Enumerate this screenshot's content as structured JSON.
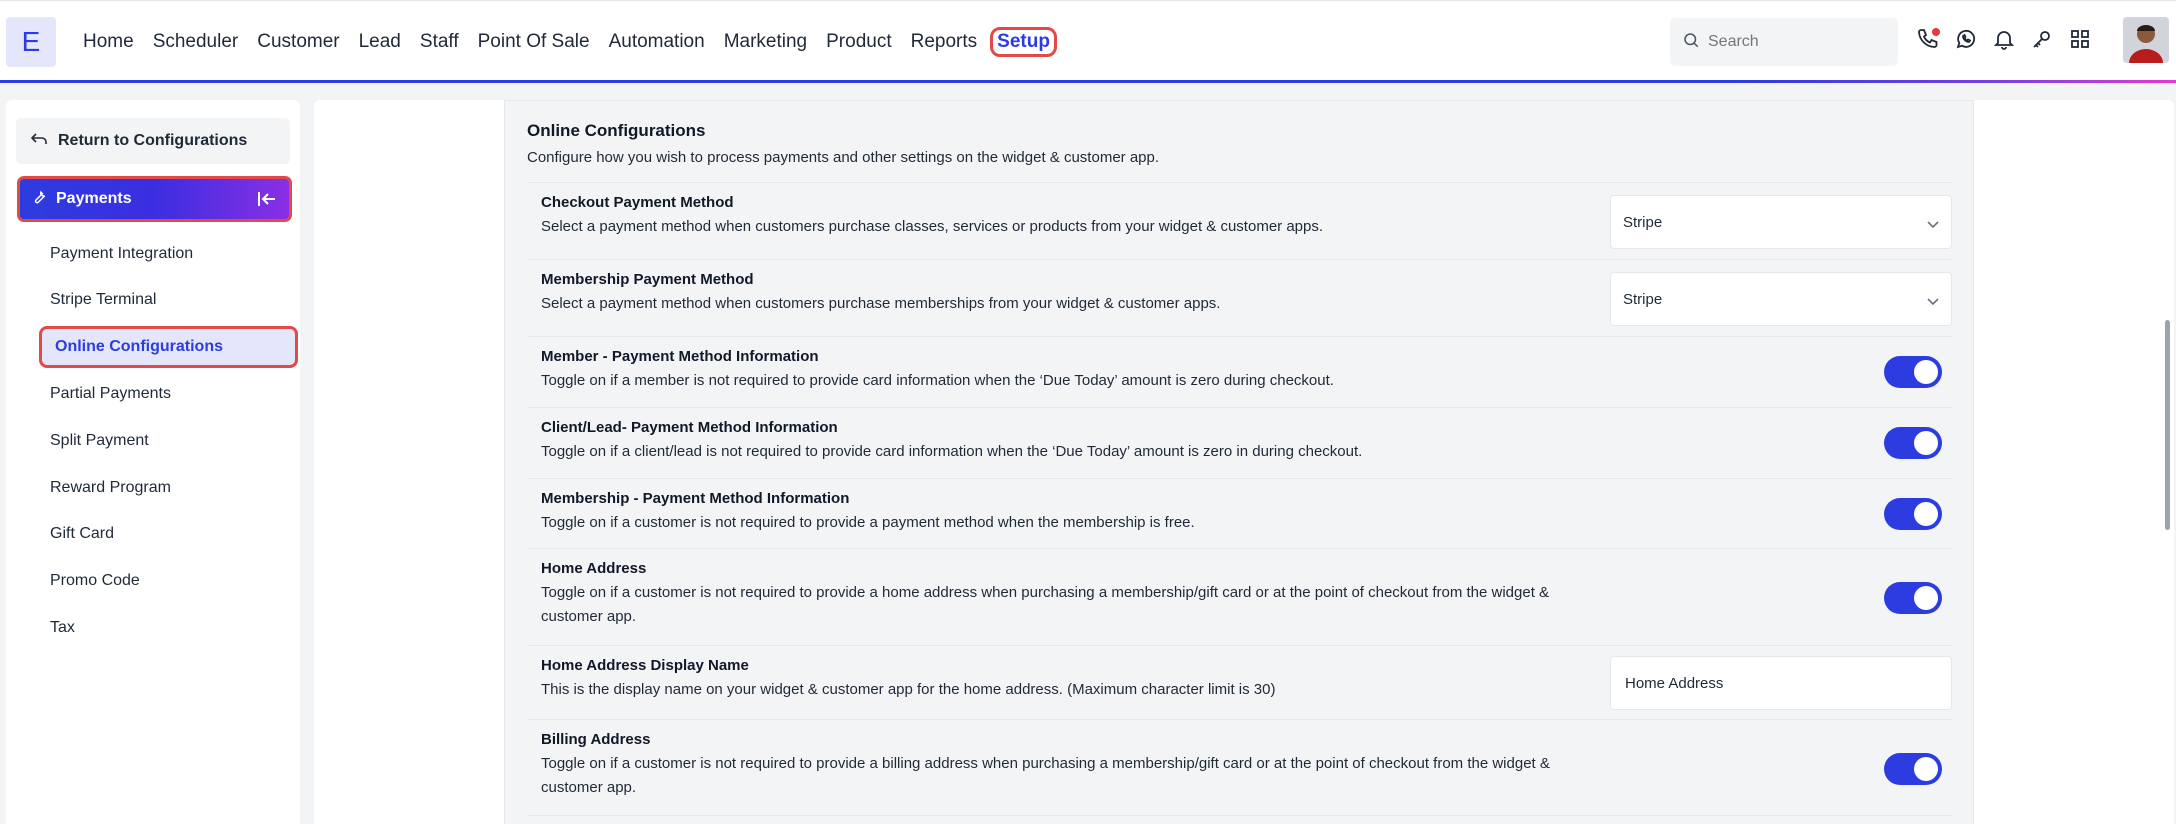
{
  "logo": {
    "letter": "E"
  },
  "nav": {
    "items": [
      "Home",
      "Scheduler",
      "Customer",
      "Lead",
      "Staff",
      "Point Of Sale",
      "Automation",
      "Marketing",
      "Product",
      "Reports"
    ],
    "active": "Setup"
  },
  "search": {
    "placeholder": "Search"
  },
  "sidebar": {
    "return_label": "Return to Configurations",
    "section_label": "Payments",
    "items": [
      "Payment Integration",
      "Stripe Terminal",
      "Online Configurations",
      "Partial Payments",
      "Split Payment",
      "Reward Program",
      "Gift Card",
      "Promo Code",
      "Tax"
    ],
    "active_index": 2
  },
  "panel": {
    "title": "Online Configurations",
    "description": "Configure how you wish to process payments and other settings on the widget & customer app.",
    "rows": [
      {
        "title": "Checkout Payment Method",
        "desc": "Select a payment method when customers purchase classes, services or products from your widget & customer apps.",
        "control": "select",
        "value": "Stripe"
      },
      {
        "title": "Membership Payment Method",
        "desc": "Select a payment method when customers purchase memberships from your widget & customer apps.",
        "control": "select",
        "value": "Stripe"
      },
      {
        "title": "Member - Payment Method Information",
        "desc": "Toggle on if a member is not required to provide card information when the ‘Due Today’ amount is zero during checkout.",
        "control": "toggle",
        "on": true
      },
      {
        "title": "Client/Lead- Payment Method Information",
        "desc": "Toggle on if a client/lead is not required to provide card information when the ‘Due Today’ amount is zero in during checkout.",
        "control": "toggle",
        "on": true
      },
      {
        "title": "Membership - Payment Method Information",
        "desc": "Toggle on if a customer is not required to provide a payment method when the membership is free.",
        "control": "toggle",
        "on": true
      },
      {
        "title": "Home Address",
        "desc": "Toggle on if a customer is not required to provide a home address when purchasing a membership/gift card or at the point of checkout from the widget & customer app.",
        "control": "toggle",
        "on": true
      },
      {
        "title": "Home Address Display Name",
        "desc": "This is the display name on your widget & customer app for the home address. (Maximum character limit is 30)",
        "control": "input",
        "value": "Home Address"
      },
      {
        "title": "Billing Address",
        "desc": "Toggle on if a customer is not required to provide a billing address when purchasing a membership/gift card or at the point of checkout from the widget & customer app.",
        "control": "toggle",
        "on": true
      }
    ]
  },
  "colors": {
    "accent": "#2d3ce0",
    "highlight": "#e24a4a",
    "active_bg": "#e4e6fb"
  }
}
